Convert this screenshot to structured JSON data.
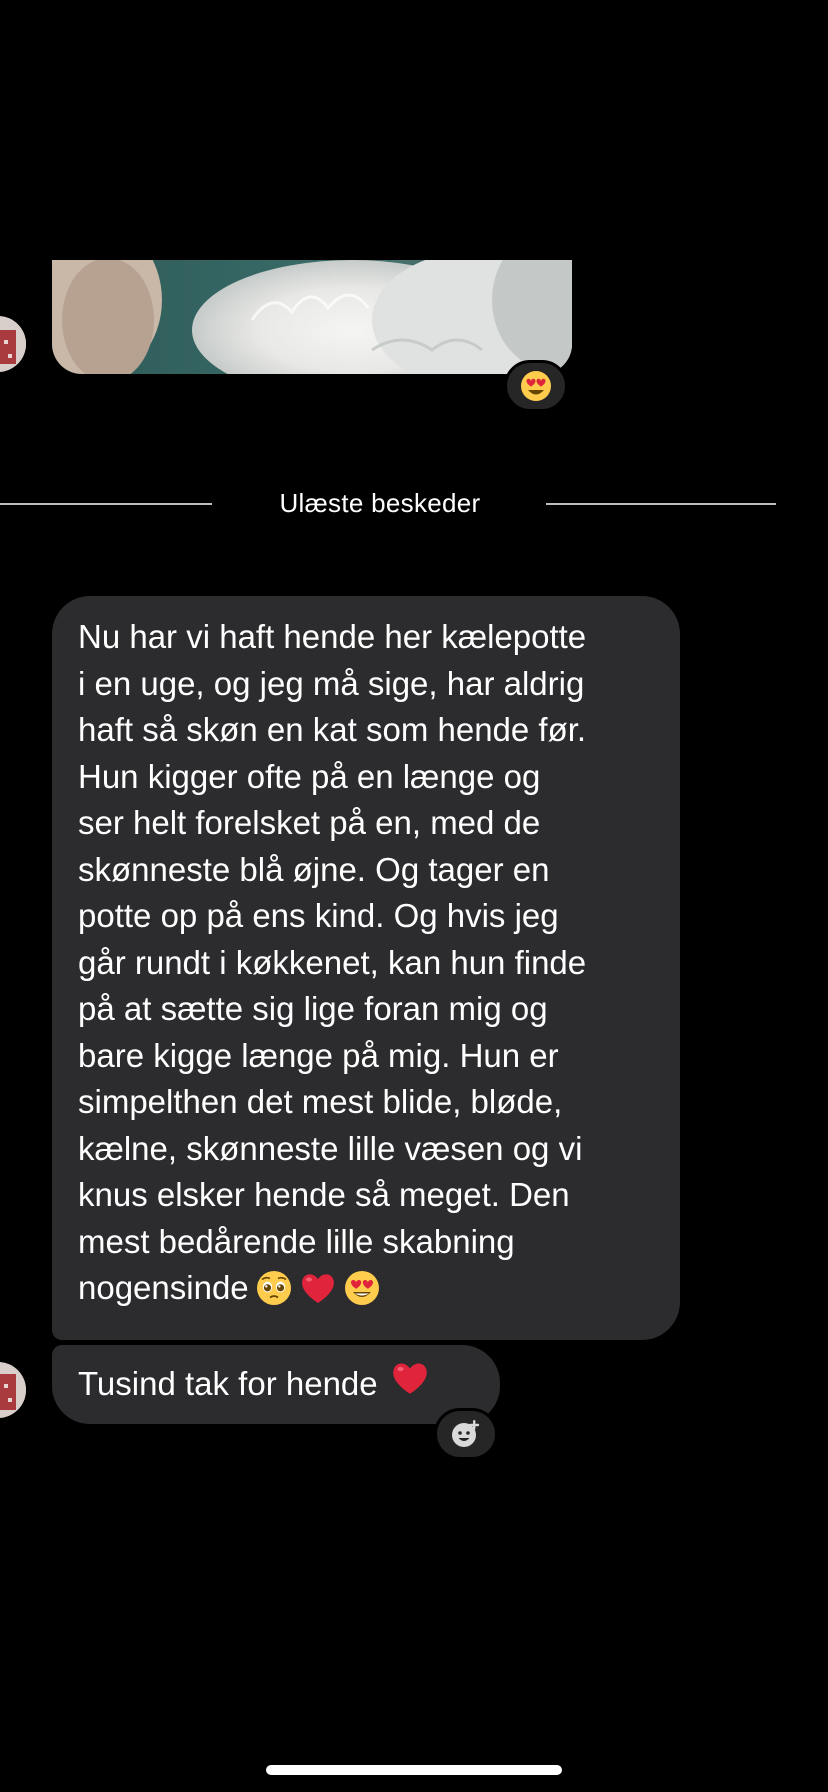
{
  "thread": {
    "image_message": {
      "reaction_emoji": "heart-eyes-emoji"
    },
    "unread_divider": {
      "label": "Ulæste beskeder"
    },
    "messages": [
      {
        "lines": [
          "Nu har vi haft hende her kælepotte",
          "i en uge, og jeg må sige, har aldrig",
          "haft så skøn en kat som hende før.",
          "Hun kigger ofte på en længe og",
          "ser helt forelsket på en, med de",
          "skønneste blå øjne. Og tager en",
          "potte op på ens kind. Og hvis jeg",
          "går rundt i køkkenet, kan hun finde",
          "på at sætte sig lige foran mig og",
          "bare kigge længe på mig. Hun er",
          "simpelthen det mest blide, bløde,",
          "kælne, skønneste lille væsen og vi",
          "knus elsker hende så meget. Den",
          "mest bedårende lille skabning",
          "nogensinde"
        ],
        "emojis": [
          "pleading-face-emoji",
          "red-heart-emoji",
          "heart-eyes-emoji"
        ]
      },
      {
        "text": "Tusind tak for hende",
        "emojis": [
          "red-heart-emoji"
        ]
      }
    ],
    "add_reaction_icon": "add-reaction-icon"
  },
  "colors": {
    "background": "#000000",
    "bubble": "#2c2c2e",
    "text": "#ffffff",
    "divider": "#bfbfbf"
  }
}
